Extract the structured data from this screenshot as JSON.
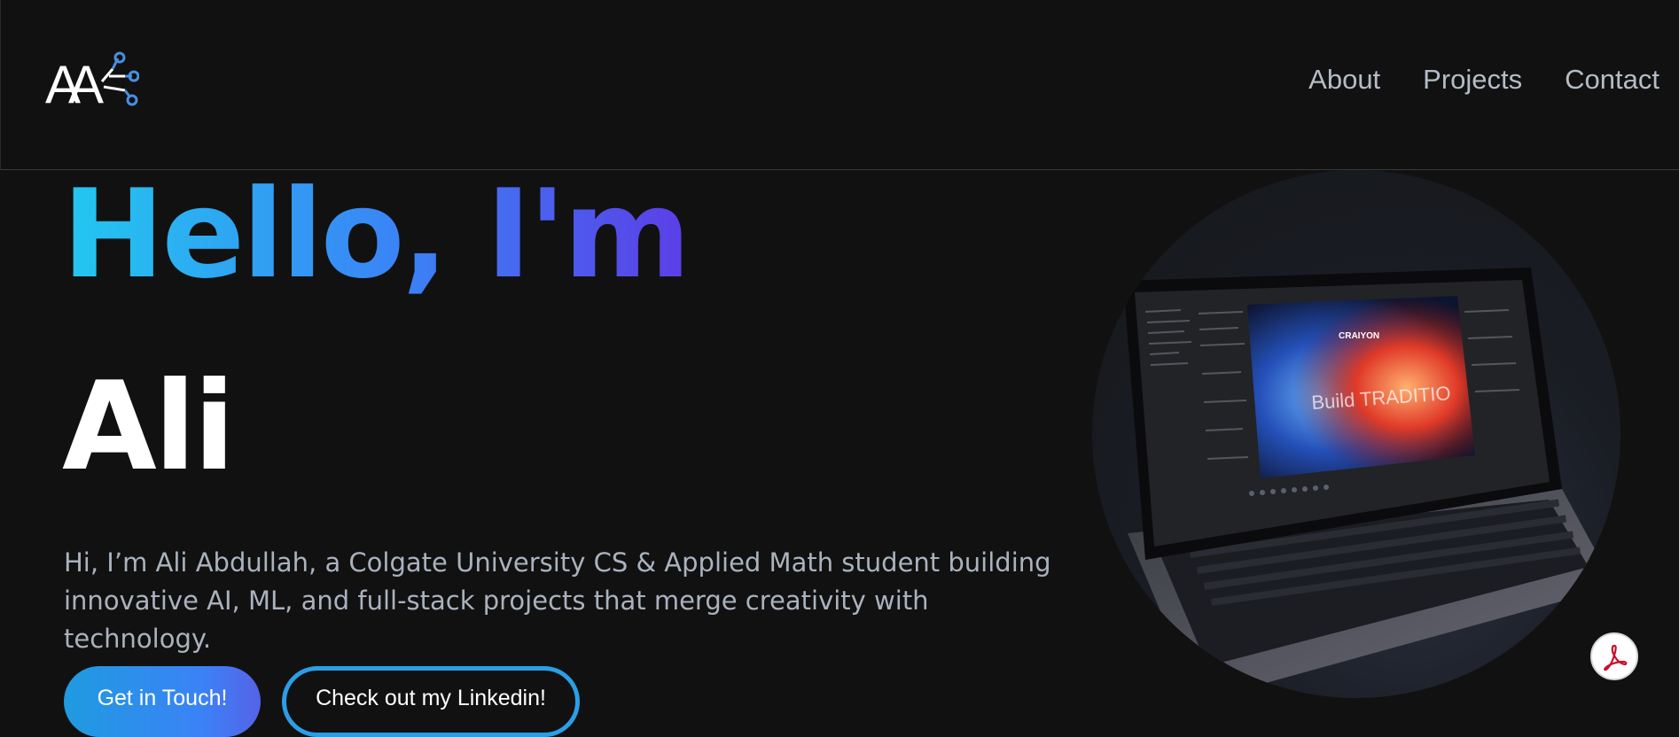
{
  "brand": {
    "logo_text": "AA",
    "logo_icon": "network-nodes-icon"
  },
  "nav": {
    "items": [
      {
        "label": "About"
      },
      {
        "label": "Projects"
      },
      {
        "label": "Contact"
      }
    ]
  },
  "hero": {
    "greeting": "Hello, I'm",
    "name": "Ali",
    "intro": "Hi, I’m Ali Abdullah, a Colgate University CS & Applied Math student building innovative AI, ML, and full-stack projects that merge creativity with technology.",
    "primary_button": "Get in Touch!",
    "secondary_button": "Check out my Linkedin!",
    "image_alt": "laptop-photo",
    "screen_text": "CRAIYON",
    "screen_art_text": "Build TRADITIO"
  },
  "floating": {
    "pdf_icon": "acrobat-pdf-icon"
  },
  "colors": {
    "background": "#111111",
    "nav_text": "#b4bcc8",
    "intro_text": "#a9b2be",
    "gradient_start": "#22c8ef",
    "gradient_mid": "#3b82f6",
    "gradient_end": "#5b3ee6",
    "accent_blue": "#2b9ee6",
    "pdf_red": "#c8102e"
  }
}
